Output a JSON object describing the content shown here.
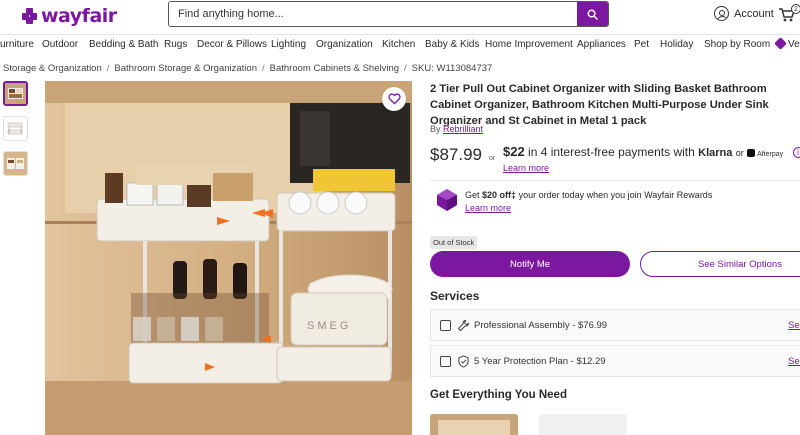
{
  "brand": {
    "name": "wayfair",
    "color": "#7b189f"
  },
  "search": {
    "placeholder": "Find anything home...",
    "icon": "search-icon"
  },
  "header": {
    "account_label": "Account",
    "cart_count": "2"
  },
  "nav": {
    "items": [
      "urniture",
      "Outdoor",
      "Bedding & Bath",
      "Rugs",
      "Decor & Pillows",
      "Lighting",
      "Organization",
      "Kitchen",
      "Baby & Kids",
      "Home Improvement",
      "Appliances",
      "Pet",
      "Holiday",
      "Shop by Room",
      "Ver"
    ]
  },
  "breadcrumb": {
    "items": [
      "Storage & Organization",
      "Bathroom Storage & Organization",
      "Bathroom Cabinets & Shelving"
    ],
    "sku": "SKU: W113084737"
  },
  "product": {
    "title": "2 Tier Pull Out Cabinet Organizer with Sliding Basket Bathroom Cabinet Organizer, Bathroom Kitchen Multi-Purpose Under Sink Organizer and St Cabinet in Metal 1 pack",
    "by_prefix": "By",
    "brand": "Rebrilliant",
    "price": "$87.99",
    "or": "or",
    "installment_amount": "$22",
    "installment_text": "in 4 interest-free payments with",
    "klarna": "Klarna",
    "or2": "or",
    "afterpay": "Afterpay",
    "learn_more": "Learn more",
    "rewards_prefix": "Get",
    "rewards_amount": "$20 off‡",
    "rewards_suffix": "your order today when you join Wayfair Rewards",
    "rewards_learn_more": "Learn more",
    "stock_status": "Out of Stock",
    "notify_label": "Notify Me",
    "similar_label": "See Similar Options"
  },
  "services": {
    "heading": "Services",
    "items": [
      {
        "label": "Professional Assembly - $76.99",
        "icon": "wrench-icon",
        "link": "See"
      },
      {
        "label": "5 Year Protection Plan - $12.29",
        "icon": "shield-icon",
        "link": "See"
      }
    ]
  },
  "everything": {
    "heading": "Get Everything You Need"
  }
}
